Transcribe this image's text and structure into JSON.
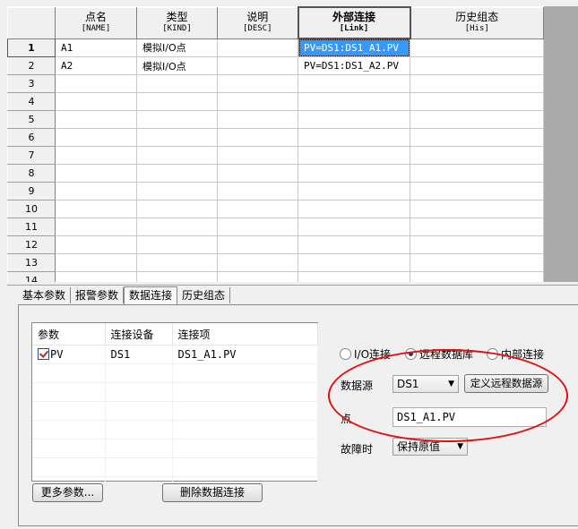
{
  "grid": {
    "columns": [
      {
        "name": "点名",
        "sub": "[NAME]"
      },
      {
        "name": "类型",
        "sub": "[KIND]"
      },
      {
        "name": "说明",
        "sub": "[DESC]"
      },
      {
        "name": "外部连接",
        "sub": "[Link]"
      },
      {
        "name": "历史组态",
        "sub": "[His]"
      }
    ],
    "rows": [
      {
        "num": "1",
        "name": "A1",
        "kind": "模拟I/O点",
        "desc": "",
        "link": "PV=DS1:DS1_A1.PV",
        "his": ""
      },
      {
        "num": "2",
        "name": "A2",
        "kind": "模拟I/O点",
        "desc": "",
        "link": "PV=DS1:DS1_A2.PV",
        "his": ""
      },
      {
        "num": "3",
        "name": "",
        "kind": "",
        "desc": "",
        "link": "",
        "his": ""
      },
      {
        "num": "4",
        "name": "",
        "kind": "",
        "desc": "",
        "link": "",
        "his": ""
      },
      {
        "num": "5",
        "name": "",
        "kind": "",
        "desc": "",
        "link": "",
        "his": ""
      },
      {
        "num": "6",
        "name": "",
        "kind": "",
        "desc": "",
        "link": "",
        "his": ""
      },
      {
        "num": "7",
        "name": "",
        "kind": "",
        "desc": "",
        "link": "",
        "his": ""
      },
      {
        "num": "8",
        "name": "",
        "kind": "",
        "desc": "",
        "link": "",
        "his": ""
      },
      {
        "num": "9",
        "name": "",
        "kind": "",
        "desc": "",
        "link": "",
        "his": ""
      },
      {
        "num": "10",
        "name": "",
        "kind": "",
        "desc": "",
        "link": "",
        "his": ""
      },
      {
        "num": "11",
        "name": "",
        "kind": "",
        "desc": "",
        "link": "",
        "his": ""
      },
      {
        "num": "12",
        "name": "",
        "kind": "",
        "desc": "",
        "link": "",
        "his": ""
      },
      {
        "num": "13",
        "name": "",
        "kind": "",
        "desc": "",
        "link": "",
        "his": ""
      },
      {
        "num": "14",
        "name": "",
        "kind": "",
        "desc": "",
        "link": "",
        "his": ""
      }
    ]
  },
  "tabs": [
    "基本参数",
    "报警参数",
    "数据连接",
    "历史组态"
  ],
  "active_tab": "数据连接",
  "param_list": {
    "headers": [
      "参数",
      "连接设备",
      "连接项"
    ],
    "rows": [
      {
        "param": "PV",
        "device": "DS1",
        "item": "DS1_A1.PV",
        "checked": true
      }
    ]
  },
  "buttons": {
    "more_params": "更多参数...",
    "delete_link": "删除数据连接",
    "define_remote": "定义远程数据源"
  },
  "link_type": {
    "options": [
      "I/O连接",
      "远程数据库",
      "内部连接"
    ],
    "selected": "远程数据库"
  },
  "form": {
    "source_label": "数据源",
    "source_value": "DS1",
    "point_label": "点",
    "point_value": "DS1_A1.PV",
    "fault_label": "故障时",
    "fault_value": "保持原值"
  },
  "colors": {
    "selection": "#3399ff",
    "annotation": "#e01010"
  }
}
